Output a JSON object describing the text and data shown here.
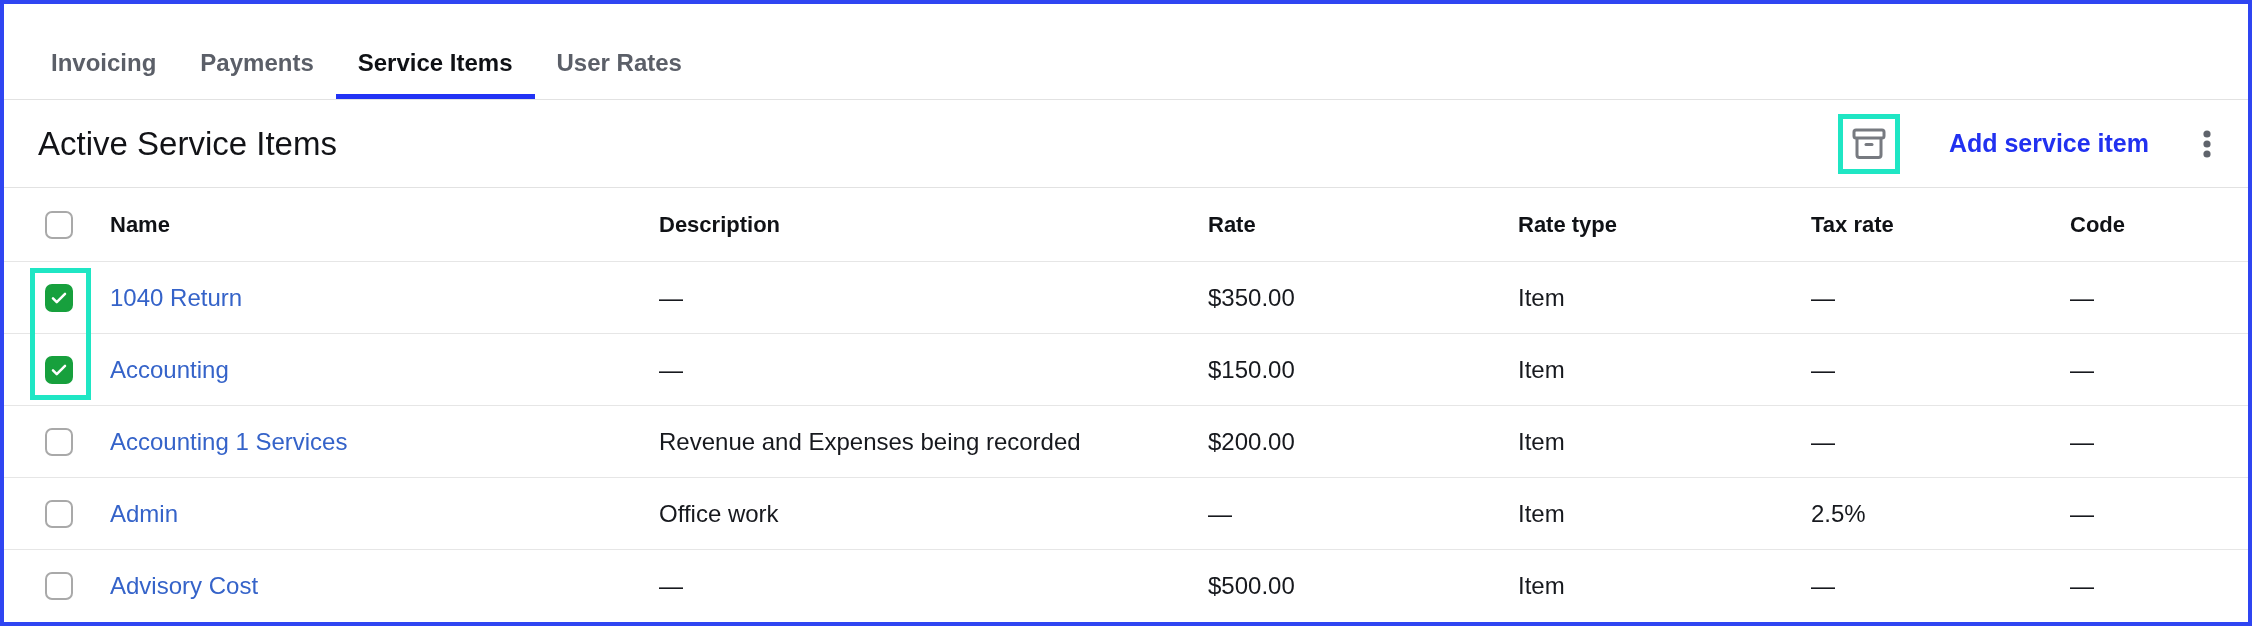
{
  "tabs": [
    {
      "label": "Invoicing",
      "selected": false
    },
    {
      "label": "Payments",
      "selected": false
    },
    {
      "label": "Service Items",
      "selected": true
    },
    {
      "label": "User Rates",
      "selected": false
    }
  ],
  "header": {
    "title": "Active Service Items",
    "archive_button": {
      "highlighted": true
    },
    "add_button": {
      "label": "Add service item"
    }
  },
  "table": {
    "select_all": {
      "checked": false
    },
    "columns": [
      {
        "label": "Name",
        "kind": "link"
      },
      {
        "label": "Description",
        "kind": "text"
      },
      {
        "label": "Rate",
        "kind": "text"
      },
      {
        "label": "Rate type",
        "kind": "text"
      },
      {
        "label": "Tax rate",
        "kind": "text"
      },
      {
        "label": "Code",
        "kind": "text"
      }
    ],
    "rows": [
      {
        "checked": true,
        "highlighted": true,
        "cells": [
          "1040 Return",
          "—",
          "$350.00",
          "Item",
          "—",
          "—"
        ]
      },
      {
        "checked": true,
        "highlighted": true,
        "cells": [
          "Accounting",
          "—",
          "$150.00",
          "Item",
          "—",
          "—"
        ]
      },
      {
        "checked": false,
        "highlighted": false,
        "cells": [
          "Accounting 1 Services",
          "Revenue and Expenses being recorded",
          "$200.00",
          "Item",
          "—",
          "—"
        ]
      },
      {
        "checked": false,
        "highlighted": false,
        "cells": [
          "Admin",
          "Office work",
          "—",
          "Item",
          "2.5%",
          "—"
        ]
      },
      {
        "checked": false,
        "highlighted": false,
        "cells": [
          "Advisory Cost",
          "—",
          "$500.00",
          "Item",
          "—",
          "—"
        ]
      }
    ]
  }
}
